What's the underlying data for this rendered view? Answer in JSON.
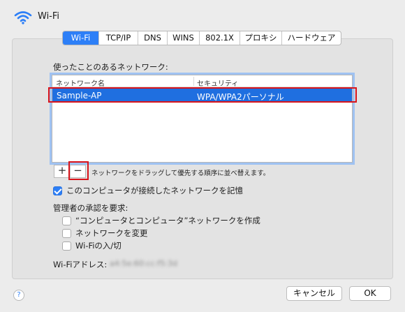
{
  "window": {
    "title": "Wi-Fi",
    "icon": "wifi-icon"
  },
  "tabs": [
    {
      "label": "Wi-Fi",
      "active": true
    },
    {
      "label": "TCP/IP"
    },
    {
      "label": "DNS"
    },
    {
      "label": "WINS"
    },
    {
      "label": "802.1X"
    },
    {
      "label": "プロキシ"
    },
    {
      "label": "ハードウェア"
    }
  ],
  "networks": {
    "label": "使ったことのあるネットワーク:",
    "columns": [
      "ネットワーク名",
      "セキュリティ"
    ],
    "rows": [
      {
        "name": "Sample-AP",
        "security": "WPA/WPA2パーソナル",
        "selected": true
      }
    ]
  },
  "list_controls": {
    "add_label": "+",
    "remove_label": "−",
    "hint": "ネットワークをドラッグして優先する順序に並べ替えます。"
  },
  "remember": {
    "label": "このコンピュータが接続したネットワークを記憶",
    "checked": true
  },
  "admin": {
    "label": "管理者の承認を要求:",
    "options": [
      {
        "label": "“コンピュータとコンピュータ”ネットワークを作成",
        "checked": false
      },
      {
        "label": "ネットワークを変更",
        "checked": false
      },
      {
        "label": "Wi-Fiの入/切",
        "checked": false
      }
    ]
  },
  "wifi_address": {
    "label": "Wi-Fiアドレス:",
    "value": "a4:5e:60:cc:f5:3d"
  },
  "footer": {
    "help_label": "?",
    "cancel_label": "キャンセル",
    "ok_label": "OK"
  },
  "colors": {
    "accent": "#2d7ff7",
    "selection": "#1f6fe0",
    "annotation": "#d9141b"
  }
}
